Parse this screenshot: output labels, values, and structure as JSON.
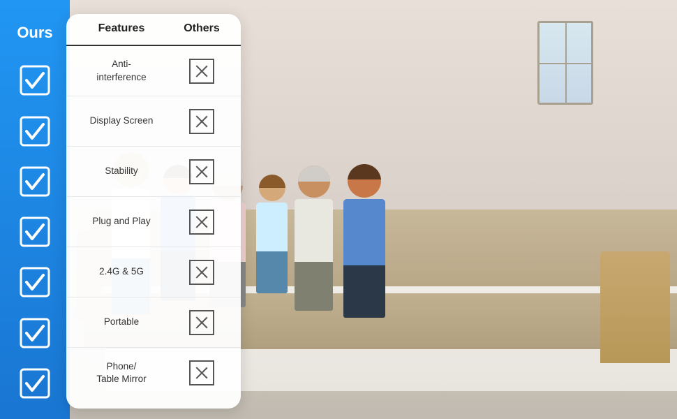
{
  "sidebar": {
    "label": "Ours",
    "checks": [
      {
        "id": "check-1"
      },
      {
        "id": "check-2"
      },
      {
        "id": "check-3"
      },
      {
        "id": "check-4"
      },
      {
        "id": "check-5"
      },
      {
        "id": "check-6"
      },
      {
        "id": "check-7"
      }
    ]
  },
  "table": {
    "col_features": "Features",
    "col_others": "Others",
    "rows": [
      {
        "feature": "Anti-interference"
      },
      {
        "feature": "Display Screen"
      },
      {
        "feature": "Stability"
      },
      {
        "feature": "Plug and Play"
      },
      {
        "feature": "2.4G & 5G"
      },
      {
        "feature": "Portable"
      },
      {
        "feature": "Phone/\nTable Mirror"
      }
    ]
  },
  "colors": {
    "blue": "#2196F3",
    "blue_dark": "#1976D2",
    "white": "#ffffff",
    "check_color": "#ffffff",
    "x_border": "#555555"
  }
}
